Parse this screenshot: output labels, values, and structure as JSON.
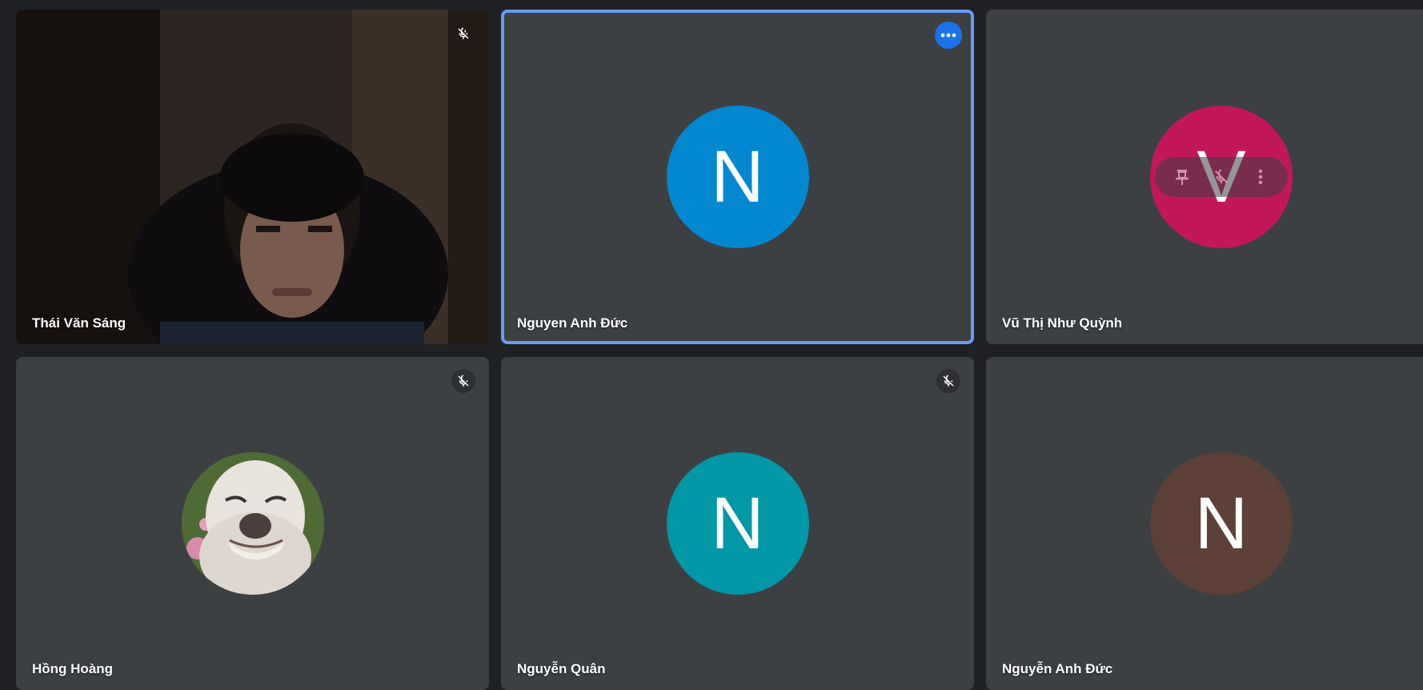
{
  "participants": [
    {
      "name": "Thái Văn Sáng",
      "kind": "video",
      "muted": true,
      "icons": {
        "mute": "mic-off-icon"
      }
    },
    {
      "name": "Nguyen Anh Đức",
      "kind": "avatar",
      "initial": "N",
      "avatar_color": "#0288d1",
      "active": true,
      "icons": {
        "more": "more-options-icon"
      }
    },
    {
      "name": "Vũ Thị Như Quỳnh",
      "kind": "avatar",
      "initial": "V",
      "avatar_color": "#c2185b",
      "hover_controls": [
        "pin-icon",
        "mic-off-icon",
        "more-vert-icon"
      ]
    },
    {
      "name": "Hồng Hoàng",
      "kind": "photo",
      "muted": true,
      "icons": {
        "mute": "mic-off-icon"
      }
    },
    {
      "name": "Nguyễn Quân",
      "kind": "avatar",
      "initial": "N",
      "avatar_color": "#0097a7",
      "muted": true,
      "icons": {
        "mute": "mic-off-icon"
      }
    },
    {
      "name": "Nguyễn Anh Đức",
      "kind": "avatar",
      "initial": "N",
      "avatar_color": "#5d4037"
    }
  ],
  "colors": {
    "background": "#202124",
    "tile": "#3c4043",
    "active_border": "#669df6",
    "more_button": "#1a73e8"
  }
}
